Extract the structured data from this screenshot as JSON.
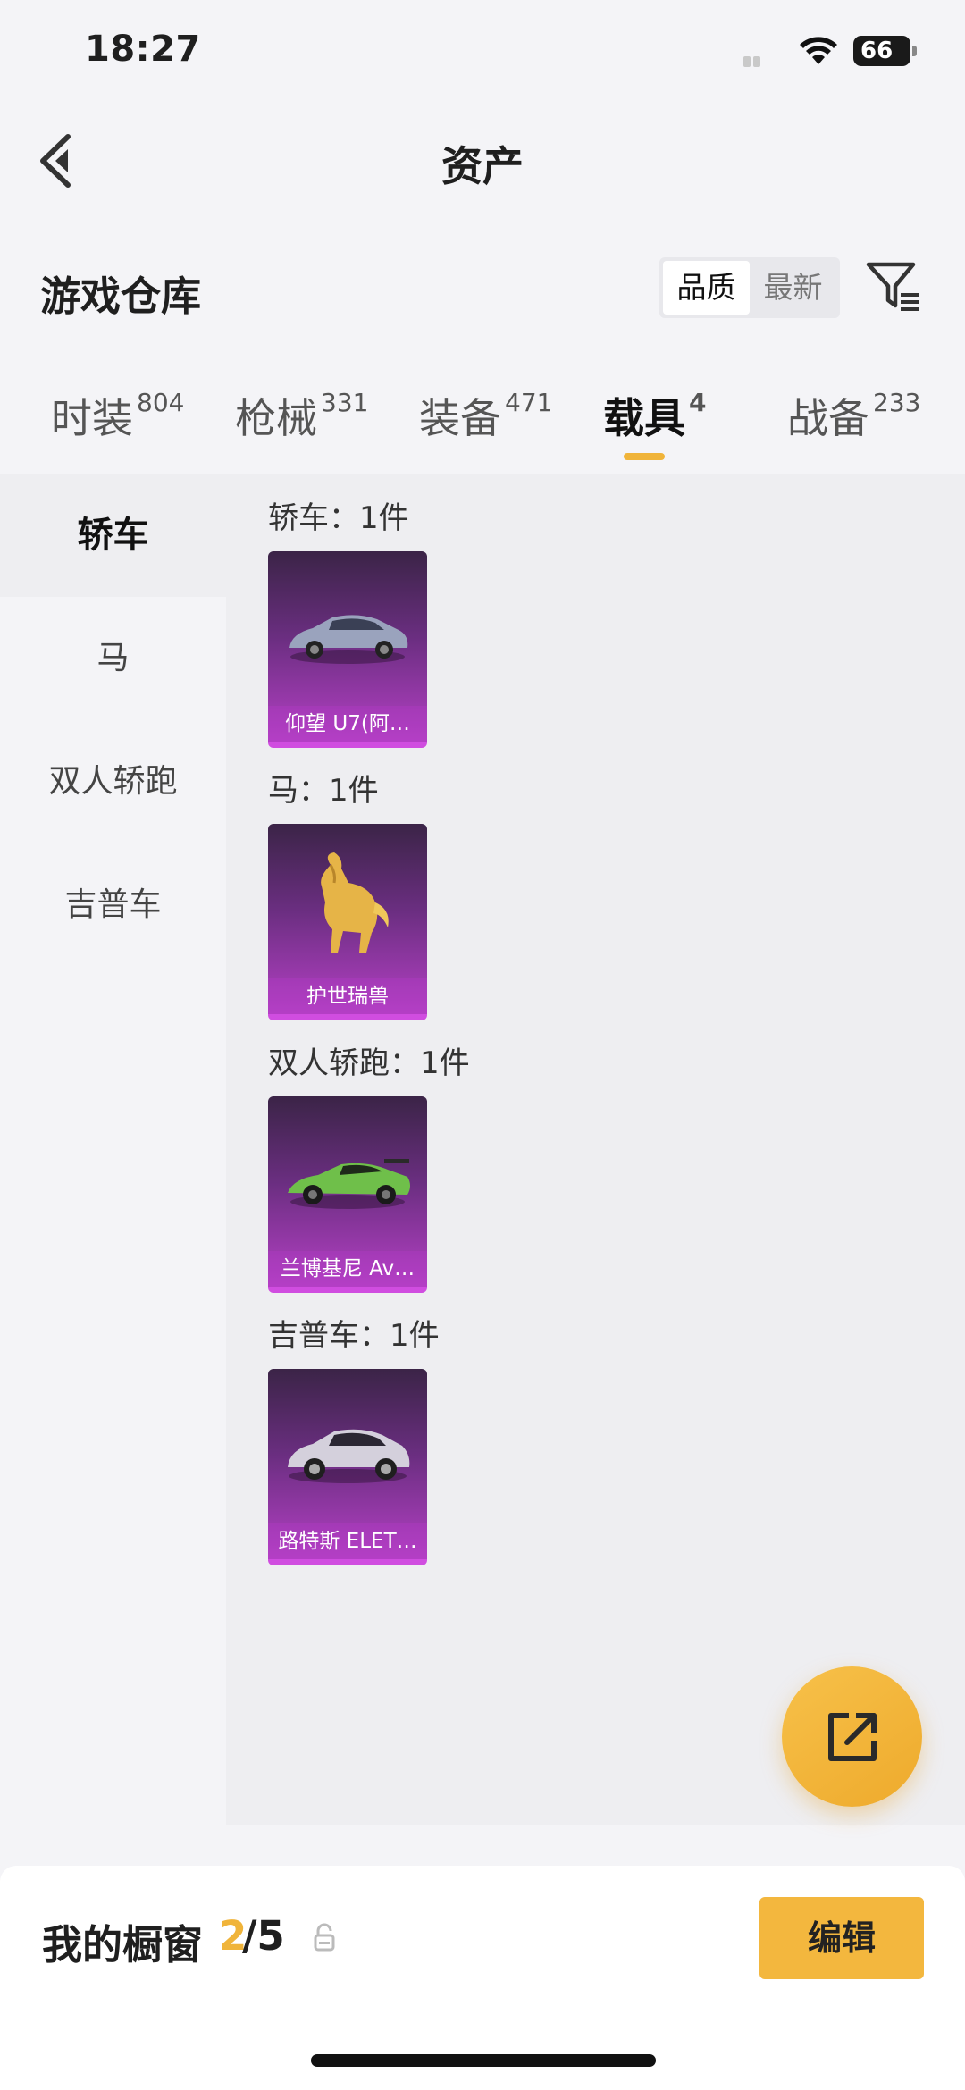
{
  "status": {
    "time": "18:27",
    "battery": "66"
  },
  "nav": {
    "title": "资产"
  },
  "warehouse": {
    "title": "游戏仓库",
    "sort_options": [
      "品质",
      "最新"
    ],
    "active_sort": "品质"
  },
  "tabs": [
    {
      "label": "时装",
      "count": "804"
    },
    {
      "label": "枪械",
      "count": "331"
    },
    {
      "label": "装备",
      "count": "471"
    },
    {
      "label": "载具",
      "count": "4"
    },
    {
      "label": "战备",
      "count": "233"
    }
  ],
  "active_tab": "载具",
  "sidebar": {
    "items": [
      {
        "label": "轿车"
      },
      {
        "label": "马"
      },
      {
        "label": "双人轿跑"
      },
      {
        "label": "吉普车"
      }
    ],
    "active": "轿车"
  },
  "sections": [
    {
      "title": "轿车：1件",
      "item": {
        "name": "仰望 U7(阿…",
        "icon": "sedan-car-icon"
      }
    },
    {
      "title": "马：1件",
      "item": {
        "name": "护世瑞兽",
        "icon": "golden-horse-icon"
      }
    },
    {
      "title": "双人轿跑：1件",
      "item": {
        "name": "兰博基尼 Av…",
        "icon": "sports-car-icon"
      }
    },
    {
      "title": "吉普车：1件",
      "item": {
        "name": "路特斯 ELET…",
        "icon": "suv-car-icon"
      }
    }
  ],
  "showcase": {
    "title": "我的橱窗",
    "current": "2",
    "total": "/5",
    "edit_label": "编辑"
  },
  "colors": {
    "accent": "#f0b43a",
    "card_purple": "#b440c4",
    "background": "#f4f4f7"
  }
}
